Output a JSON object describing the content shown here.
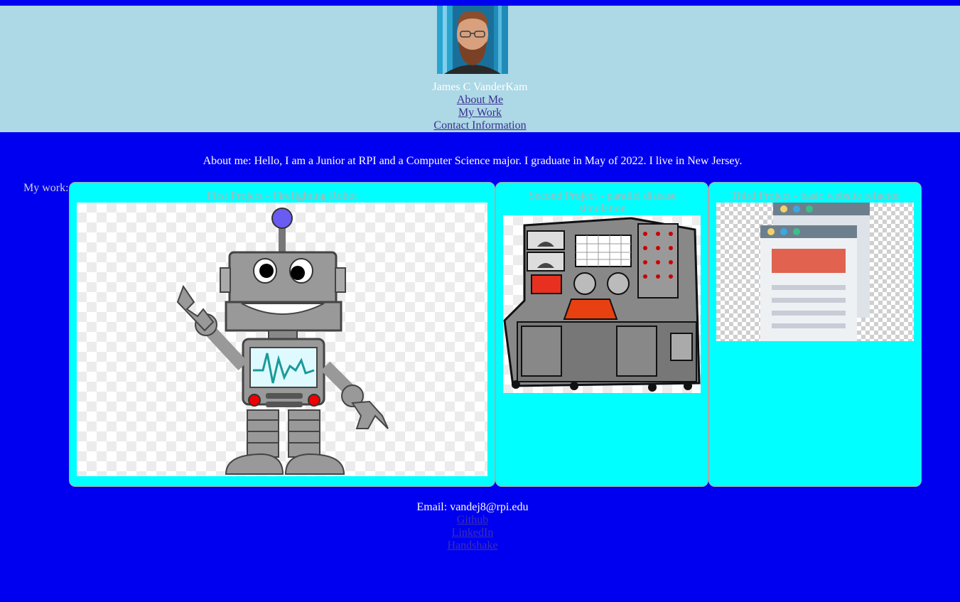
{
  "header": {
    "name": "James C VanderKam",
    "nav": [
      {
        "label": "About Me"
      },
      {
        "label": "My Work"
      },
      {
        "label": "Contact Information"
      }
    ]
  },
  "about": {
    "text": "About me: Hello, I am a Junior at RPI and a Computer Science major. I graduate in May of 2022. I live in New Jersey."
  },
  "work": {
    "label": "My work:",
    "projects": [
      {
        "title": "First Project - Firefighting Robot"
      },
      {
        "title": "Second Project - parallel disease simulation"
      },
      {
        "title": "Third Project - basic website refactor"
      }
    ]
  },
  "footer": {
    "email": "Email: vandej8@rpi.edu",
    "links": [
      {
        "label": "Github"
      },
      {
        "label": "LinkedIn"
      },
      {
        "label": "Handshake"
      }
    ]
  },
  "colors": {
    "background": "#0000f0",
    "header_bg": "#add8e6",
    "card_bg": "#00ffff"
  }
}
